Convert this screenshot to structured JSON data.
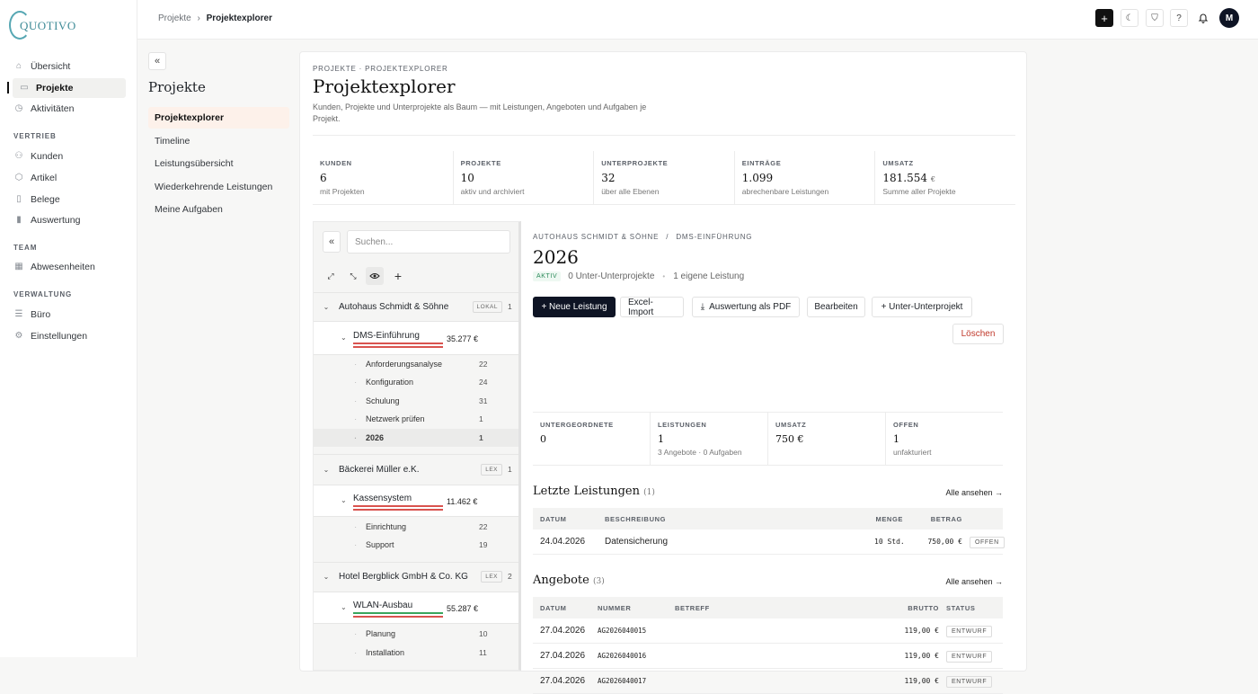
{
  "brand": {
    "name": "QUOTIVO",
    "accent": "#3f8b97"
  },
  "nav": {
    "items_top": [
      {
        "label": "Übersicht",
        "icon": "home-icon"
      },
      {
        "label": "Projekte",
        "icon": "folder-icon"
      },
      {
        "label": "Aktivitäten",
        "icon": "clock-icon"
      }
    ],
    "sections": [
      {
        "title": "VERTRIEB",
        "items": [
          {
            "label": "Kunden",
            "icon": "users-icon"
          },
          {
            "label": "Artikel",
            "icon": "box-icon"
          },
          {
            "label": "Belege",
            "icon": "file-icon"
          },
          {
            "label": "Auswertung",
            "icon": "bar-chart-icon"
          }
        ]
      },
      {
        "title": "TEAM",
        "items": [
          {
            "label": "Abwesenheiten",
            "icon": "calendar-icon"
          }
        ]
      },
      {
        "title": "VERWALTUNG",
        "items": [
          {
            "label": "Büro",
            "icon": "building-icon"
          },
          {
            "label": "Einstellungen",
            "icon": "gear-icon"
          }
        ]
      }
    ]
  },
  "topbar": {
    "crumb_parent": "Projekte",
    "crumb_sep": "›",
    "crumb_current": "Projektexplorer",
    "avatar": "M"
  },
  "subnav": {
    "title": "Projekte",
    "items": [
      "Projektexplorer",
      "Timeline",
      "Leistungsübersicht",
      "Wiederkehrende Leistungen",
      "Meine Aufgaben"
    ]
  },
  "main": {
    "kicker": "PROJEKTE · PROJEKTEXPLORER",
    "title": "Projektexplorer",
    "description": "Kunden, Projekte und Unterprojekte als Baum — mit Leistungen, Angeboten und Aufgaben je Projekt.",
    "stats": [
      {
        "label": "KUNDEN",
        "value": "6",
        "unit": "",
        "sub": "mit Projekten"
      },
      {
        "label": "PROJEKTE",
        "value": "10",
        "unit": "",
        "sub": "aktiv und archiviert"
      },
      {
        "label": "UNTERPROJEKTE",
        "value": "32",
        "unit": "",
        "sub": "über alle Ebenen"
      },
      {
        "label": "EINTRÄGE",
        "value": "1.099",
        "unit": "",
        "sub": "abrechenbare Leistungen"
      },
      {
        "label": "UMSATZ",
        "value": "181.554",
        "unit": "€",
        "sub": "Summe aller Projekte"
      }
    ]
  },
  "tree": {
    "search_placeholder": "Suchen...",
    "customers": [
      {
        "name": "Autohaus Schmidt & Söhne",
        "badge": "LOKAL",
        "count": "1",
        "project": {
          "name": "DMS-Einführung",
          "amount": "35.277 €",
          "bar_color": "#d9534f"
        },
        "subs": [
          {
            "name": "Anforderungsanalyse",
            "count": "22"
          },
          {
            "name": "Konfiguration",
            "count": "24"
          },
          {
            "name": "Schulung",
            "count": "31"
          },
          {
            "name": "Netzwerk prüfen",
            "count": "1"
          },
          {
            "name": "2026",
            "count": "1"
          }
        ]
      },
      {
        "name": "Bäckerei Müller e.K.",
        "badge": "LEX",
        "count": "1",
        "project": {
          "name": "Kassensystem",
          "amount": "11.462 €",
          "bar_color": "#d9534f"
        },
        "subs": [
          {
            "name": "Einrichtung",
            "count": "22"
          },
          {
            "name": "Support",
            "count": "19"
          }
        ]
      },
      {
        "name": "Hotel Bergblick GmbH & Co. KG",
        "badge": "LEX",
        "count": "2",
        "project": {
          "name": "WLAN-Ausbau",
          "amount": "55.287 €",
          "bar_color": "#3aa55d"
        },
        "subs": [
          {
            "name": "Planung",
            "count": "10"
          },
          {
            "name": "Installation",
            "count": "11"
          }
        ]
      }
    ]
  },
  "detail": {
    "crumb_customer": "AUTOHAUS SCHMIDT & SÖHNE",
    "crumb_sep": "/",
    "crumb_project": "DMS-EINFÜHRUNG",
    "title": "2026",
    "status": "AKTIV",
    "meta_sub": "0 Unter-Unterprojekte",
    "meta_own": "1 eigene Leistung",
    "buttons": {
      "new": "+ Neue Leistung",
      "import": "Excel-Import",
      "pdf": "Auswertung als PDF",
      "edit": "Bearbeiten",
      "subsub": "+ Unter-Unterprojekt",
      "delete": "Löschen"
    },
    "stats": [
      {
        "label": "UNTERGEORDNETE",
        "value": "0",
        "sub": ""
      },
      {
        "label": "LEISTUNGEN",
        "value": "1",
        "sub": "3 Angebote · 0 Aufgaben"
      },
      {
        "label": "UMSATZ",
        "value": "750 €",
        "sub": ""
      },
      {
        "label": "OFFEN",
        "value": "1",
        "sub": "unfakturiert"
      }
    ],
    "leistungen": {
      "title": "Letzte Leistungen",
      "count": "(1)",
      "see_all": "Alle ansehen →",
      "headers": [
        "DATUM",
        "BESCHREIBUNG",
        "MENGE",
        "BETRAG"
      ],
      "rows": [
        {
          "date": "24.04.2026",
          "desc": "Datensicherung",
          "qty": "10 Std.",
          "amount": "750,00 €",
          "status": "OFFEN"
        }
      ]
    },
    "angebote": {
      "title": "Angebote",
      "count": "(3)",
      "see_all": "Alle ansehen →",
      "headers": [
        "DATUM",
        "NUMMER",
        "BETREFF",
        "BRUTTO",
        "STATUS"
      ],
      "rows": [
        {
          "date": "27.04.2026",
          "number": "AG2026040015",
          "subject": "",
          "gross": "119,00 €",
          "status": "ENTWURF"
        },
        {
          "date": "27.04.2026",
          "number": "AG2026040016",
          "subject": "",
          "gross": "119,00 €",
          "status": "ENTWURF"
        },
        {
          "date": "27.04.2026",
          "number": "AG2026040017",
          "subject": "",
          "gross": "119,00 €",
          "status": "ENTWURF"
        }
      ]
    }
  }
}
